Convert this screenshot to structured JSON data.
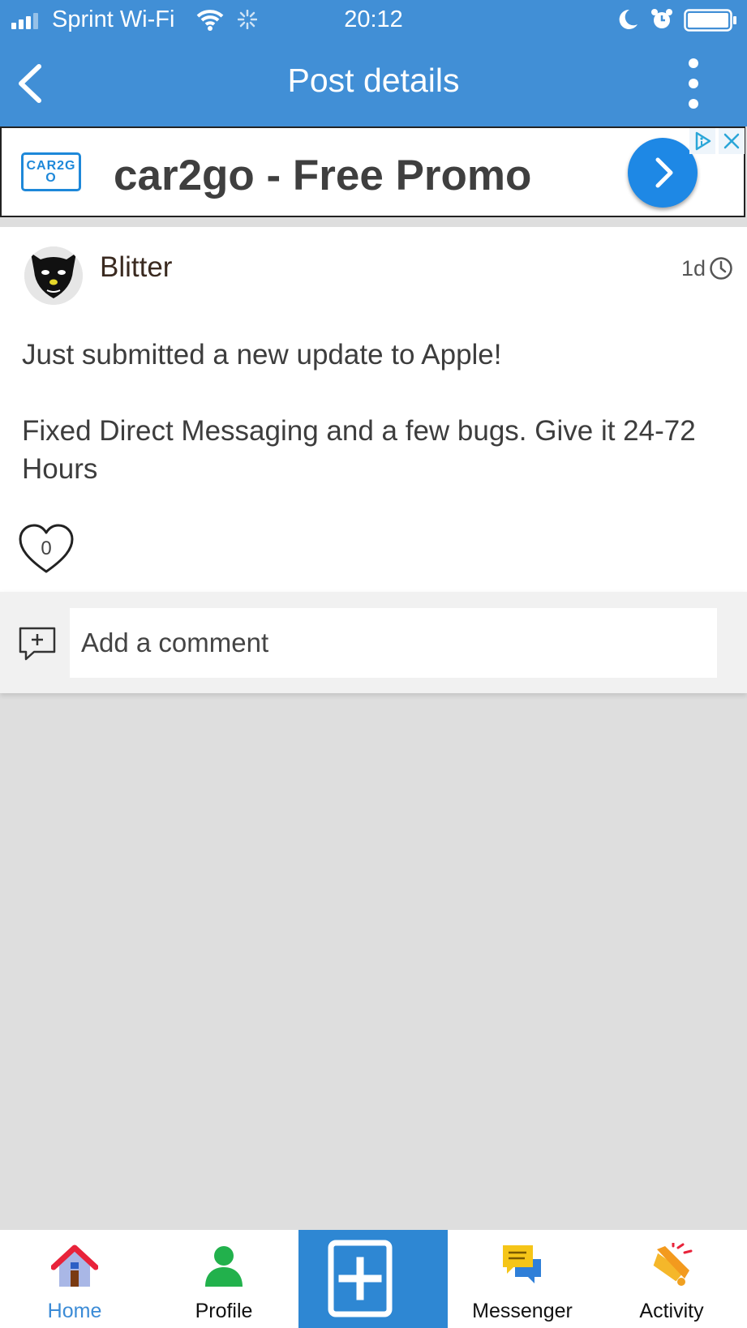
{
  "status_bar": {
    "carrier": "Sprint Wi-Fi",
    "time": "20:12"
  },
  "nav": {
    "title": "Post details"
  },
  "ad": {
    "logo_text": "CAR2GO",
    "headline": "car2go - Free Promo"
  },
  "post": {
    "username": "Blitter",
    "age": "1d",
    "paragraphs": [
      "Just submitted a new update to Apple!",
      "Fixed Direct Messaging and a few bugs. Give it 24-72 Hours"
    ],
    "likes": "0"
  },
  "comment": {
    "placeholder": "Add a comment"
  },
  "tabs": [
    {
      "label": "Home",
      "icon": "home-icon",
      "active": true
    },
    {
      "label": "Profile",
      "icon": "profile-icon"
    },
    {
      "label": "",
      "icon": "compose-icon"
    },
    {
      "label": "Messenger",
      "icon": "messenger-icon"
    },
    {
      "label": "Activity",
      "icon": "activity-icon"
    }
  ],
  "colors": {
    "accent": "#418fd6",
    "background": "#dedede",
    "ad_button": "#1e88e5"
  }
}
